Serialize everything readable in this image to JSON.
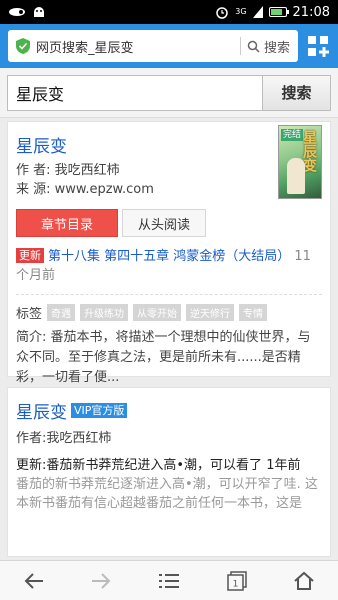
{
  "status_bar": {
    "time": "21:08",
    "network": "3G"
  },
  "browser": {
    "url_text": "网页搜索_星辰变",
    "search_label": "搜索"
  },
  "search": {
    "query": "星辰变",
    "button_label": "搜索"
  },
  "result1": {
    "title": "星辰变",
    "author": "作 者: 我吃西红柿",
    "source": "来 源: www.epzw.com",
    "cover": {
      "badge": "完结",
      "name": "星辰变"
    },
    "btn_toc": "章节目录",
    "btn_read": "从头阅读",
    "update_badge": "更新",
    "update_text": "第十八集 第四十五章 鸿蒙金榜（大结局）",
    "update_time": "11个月前",
    "tags_label": "标签",
    "tags": [
      "奇遇",
      "升级练功",
      "从零开始",
      "逆天修行",
      "专情"
    ],
    "intro": "简介: 番茄本书，将描述一个理想中的仙侠世界，与众不同。至于修真之法，更是前所未有......是否精彩，一切看了便..."
  },
  "result2": {
    "title": "星辰变",
    "vip_badge": "VIP官方版",
    "author": "作者:我吃西红柿",
    "update_text": "更新:番茄新书莽荒纪进入高•潮，可以看了",
    "update_time": "1年前",
    "desc": "番茄的新书莽荒纪逐渐进入高•潮，可以开窄了哇. 这本新书番茄有信心超越番茄之前任何一本书，这是"
  },
  "nav": {
    "tabs_count": "1"
  },
  "colors": {
    "brand_blue": "#2c8ee0",
    "link_blue": "#1a5dc8",
    "red": "#f0504a"
  },
  "icons": [
    "alarm-icon",
    "battery-icon",
    "shield-check-icon",
    "search-icon",
    "grid-menu-icon",
    "back-arrow-icon",
    "forward-arrow-icon",
    "menu-icon",
    "tabs-icon",
    "home-icon"
  ]
}
